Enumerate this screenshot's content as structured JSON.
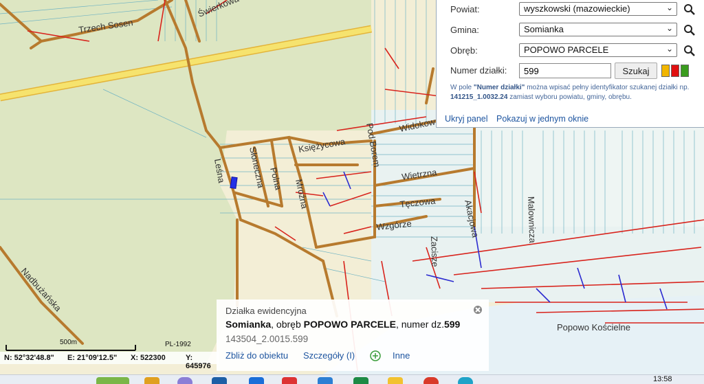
{
  "map": {
    "street_labels": [
      "Świerkowa",
      "Trzech Sosen",
      "Widokowa",
      "Księżycowa",
      "Pod Borem",
      "Słoneczna",
      "Leśna",
      "Polna",
      "Mroźna",
      "Wietrzna",
      "Tęczowa",
      "Wzgórze",
      "Akacjowa",
      "Malownicza",
      "Zacisze",
      "Nadbużańska",
      "Popowo Kościelne"
    ],
    "colors": {
      "forest": "#dde6c2",
      "residential": "#f3eed6",
      "road": "#b7792a",
      "highway": "#f3de5c",
      "water": "#e7f1f6",
      "utility_red": "#d8231c",
      "utility_blue": "#2b2bd0",
      "selected_parcel": "#1e2be0"
    }
  },
  "search_panel": {
    "powiat_label": "Powiat:",
    "powiat_value": "wyszkowski (mazowieckie)",
    "gmina_label": "Gmina:",
    "gmina_value": "Somianka",
    "obreb_label": "Obręb:",
    "obreb_value": "POPOWO PARCELE",
    "parcel_label": "Numer działki:",
    "parcel_value": "599",
    "search_button": "Szukaj",
    "hint_part1": "W pole ",
    "hint_bold1": "\"Numer działki\"",
    "hint_part2": " można wpisać pełny identyfikator szukanej działki np. ",
    "hint_bold2": "141215_1.0032.24",
    "hint_part3": " zamiast wyboru powiatu, gminy, obrębu.",
    "hide_panel": "Ukryj panel",
    "show_one_window": "Pokazuj w jednym oknie",
    "highlight_colors": [
      "#f2b600",
      "#e01010",
      "#3a9c1e"
    ]
  },
  "info_popup": {
    "heading": "Działka ewidencyjna",
    "name": "Somianka",
    "mid": ", obręb ",
    "obreb": "POPOWO PARCELE",
    "suffix": ", numer dz.",
    "number": "599",
    "identifier": "143504_2.0015.599",
    "zoom_link": "Zbliż do obiektu",
    "details_link": "Szczegóły (I)",
    "more_link": "Inne"
  },
  "scale": {
    "label": "500m",
    "crs": "PL-1992"
  },
  "coords": {
    "n": "N: 52°32'48.8\"",
    "e": "E: 21°09'12.5\"",
    "x": "X: 522300",
    "y": "Y: 645976"
  },
  "taskbar": {
    "time": "13:58"
  }
}
